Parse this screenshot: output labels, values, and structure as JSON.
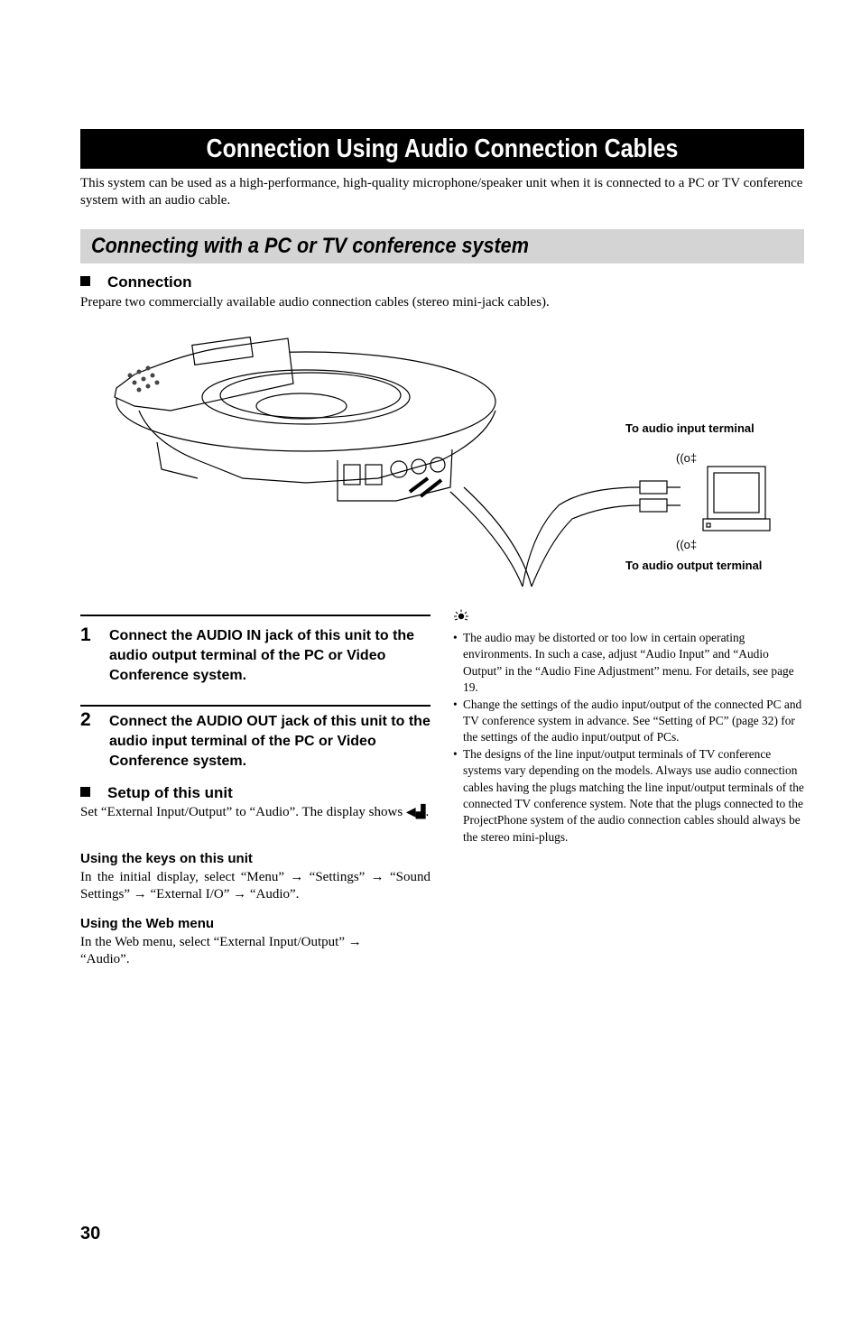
{
  "title": "Connection Using Audio Connection Cables",
  "intro": "This system can be used as a high-performance, high-quality microphone/speaker unit when it is connected to a PC or TV conference system with an audio cable.",
  "section_title": "Connecting with a PC or TV conference system",
  "connection": {
    "heading": "Connection",
    "text": "Prepare two commercially available audio connection cables (stereo mini-jack cables)."
  },
  "diagram": {
    "label_input": "To audio input terminal",
    "label_output": "To audio output terminal",
    "icons": [
      "audio-in-terminal-icon",
      "audio-out-terminal-icon"
    ]
  },
  "steps": [
    {
      "number": "1",
      "text": "Connect the AUDIO IN jack of this unit to the audio output terminal of the PC or Video Conference system."
    },
    {
      "number": "2",
      "text": "Connect the AUDIO OUT jack of this unit to the audio input terminal of the PC or Video Conference system."
    }
  ],
  "setup": {
    "heading": "Setup of this unit",
    "text_before": "Set “External Input/Output” to “Audio”. The display shows ",
    "text_after": ".",
    "keys_heading": "Using the keys on this unit",
    "keys_text": "In the initial display, select “Menu” → “Settings” → “Sound Settings” → “External I/O” → “Audio”.",
    "web_heading": "Using the Web menu",
    "web_text": "In the Web menu, select “External Input/Output” → “Audio”."
  },
  "tips": {
    "icon": "tip-lightbulb-icon",
    "items": [
      "The audio may be distorted or too low in certain operating environments. In such a case, adjust “Audio Input” and “Audio Output” in the “Audio Fine Adjustment” menu. For details, see page 19.",
      "Change the settings of the audio input/output of the connected PC and TV conference system in advance. See “Setting of PC” (page 32) for the settings of the audio input/output of PCs.",
      "The designs of the line input/output terminals of TV conference systems vary depending on the models. Always use audio connection cables having the plugs matching the line input/output terminals of the connected TV conference system. Note that the plugs connected to the ProjectPhone system of the audio connection cables should always be the stereo mini-plugs."
    ]
  },
  "page_number": "30"
}
